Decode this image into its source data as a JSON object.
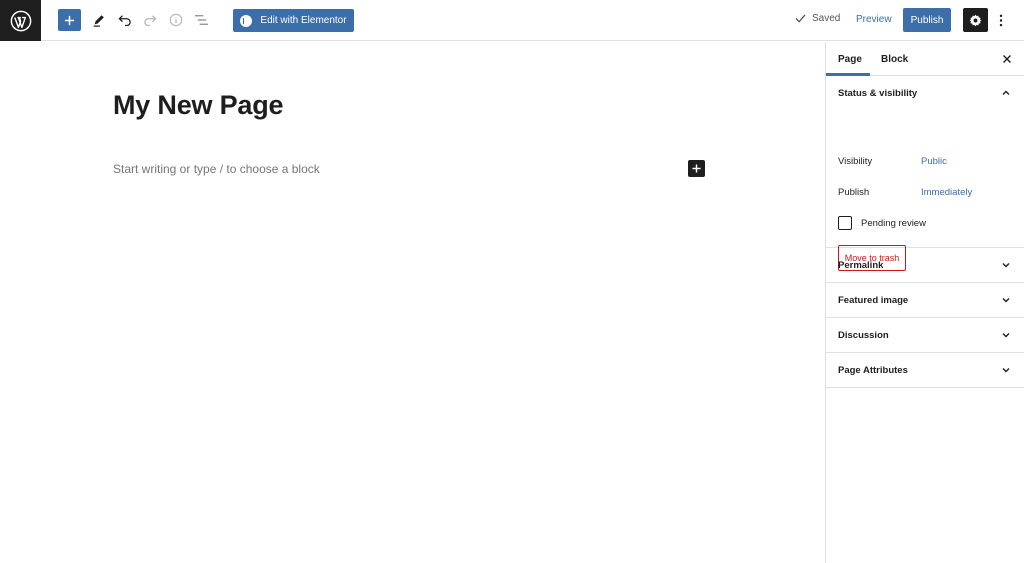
{
  "toolbar": {
    "elementor_label": "Edit with Elementor",
    "saved_label": "Saved",
    "preview_label": "Preview",
    "publish_label": "Publish"
  },
  "icons": {
    "logo": "wordpress-logo-icon",
    "add": "plus-icon",
    "tools": "pencil-icon",
    "undo": "undo-icon",
    "redo": "redo-icon",
    "info": "info-icon",
    "outline": "list-view-icon",
    "saved": "check-icon",
    "settings": "gear-icon",
    "more": "more-vertical-icon",
    "close": "close-icon",
    "collapse": "chevron-up-icon",
    "expand": "chevron-down-icon"
  },
  "editor": {
    "title": "My New Page",
    "placeholder": "Start writing or type / to choose a block"
  },
  "sidebar": {
    "tabs": [
      "Page",
      "Block"
    ],
    "active_tab": "Page",
    "status_panel": {
      "title": "Status & visibility",
      "visibility_label": "Visibility",
      "visibility_value": "Public",
      "publish_label": "Publish",
      "publish_value": "Immediately",
      "pending_label": "Pending review",
      "trash_label": "Move to trash"
    },
    "panels": [
      "Permalink",
      "Featured image",
      "Discussion",
      "Page Attributes"
    ]
  },
  "colors": {
    "accent": "#3c6ea9",
    "dark": "#1e1e1e",
    "danger": "#cc1818",
    "border": "#e0e0e0"
  }
}
